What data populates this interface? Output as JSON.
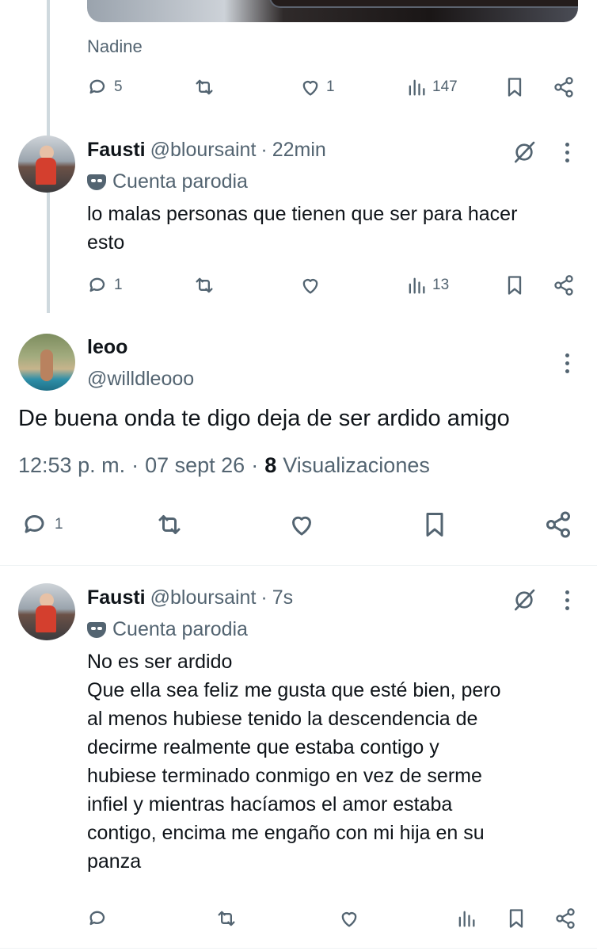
{
  "tweet1": {
    "caption": "Nadine",
    "replies": "5",
    "likes": "1",
    "views": "147"
  },
  "reply1": {
    "name": "Fausti",
    "handle": "@bloursaint",
    "separator": "·",
    "time": "22min",
    "parody": "Cuenta parodia",
    "text": "lo malas personas que tienen que ser para hacer esto",
    "replies": "1",
    "views": "13"
  },
  "main": {
    "name": "leoo",
    "handle": "@willdleooo",
    "text": "De buena onda te digo deja de ser ardido amigo",
    "time": "12:53 p. m.",
    "dot": "·",
    "date": "07 sept 26",
    "views_count": "8",
    "views_label": "Visualizaciones",
    "replies": "1"
  },
  "reply2": {
    "name": "Fausti",
    "handle": "@bloursaint",
    "separator": "·",
    "time": "7s",
    "parody": "Cuenta parodia",
    "lines": [
      "No es ser ardido",
      "Que ella sea feliz me gusta que esté bien, pero",
      "al menos hubiese tenido la descendencia de",
      "decirme realmente que estaba contigo y",
      "hubiese terminado conmigo en vez de serme",
      "infiel y mientras hacíamos el amor estaba",
      "contigo, encima me engaño con mi hija en su",
      "panza"
    ]
  },
  "icons": [
    "reply-icon",
    "retweet-icon",
    "like-icon",
    "views-icon",
    "bookmark-icon",
    "share-icon",
    "grok-icon",
    "more-icon",
    "parody-mask-icon"
  ],
  "colors": {
    "secondary_text": "#536471",
    "primary_text": "#0f1419",
    "thread_line": "#cfd9de"
  }
}
